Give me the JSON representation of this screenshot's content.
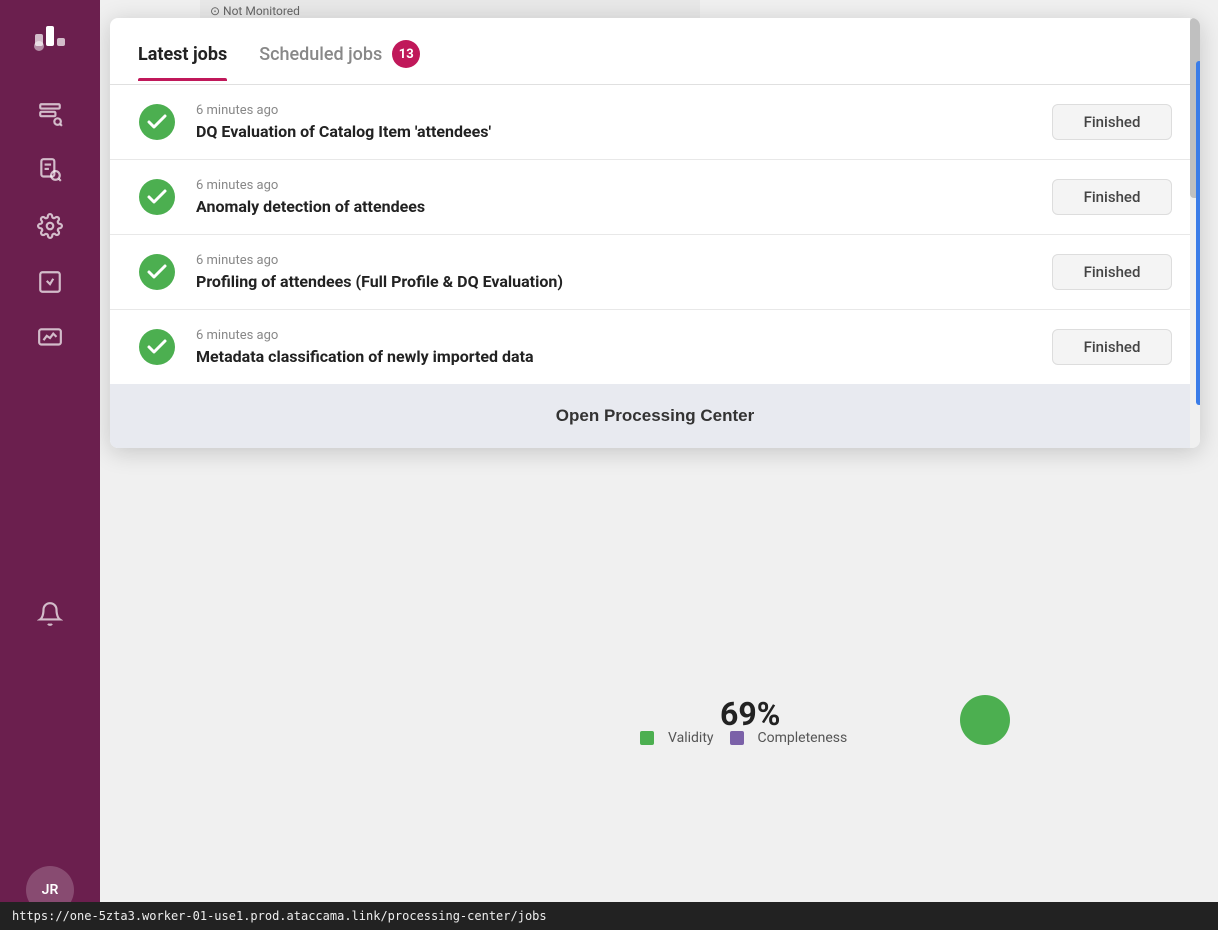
{
  "sidebar": {
    "logo_text": "bar-chart-icon",
    "items": [
      {
        "name": "sidebar-item-search",
        "icon": "search"
      },
      {
        "name": "sidebar-item-doc-search",
        "icon": "doc-search"
      },
      {
        "name": "sidebar-item-settings",
        "icon": "settings"
      },
      {
        "name": "sidebar-item-checklist",
        "icon": "checklist"
      },
      {
        "name": "sidebar-item-monitor",
        "icon": "monitor"
      },
      {
        "name": "sidebar-item-bell",
        "icon": "bell"
      }
    ],
    "avatar_label": "JR"
  },
  "tabs": {
    "latest_jobs_label": "Latest jobs",
    "scheduled_jobs_label": "Scheduled jobs",
    "scheduled_jobs_badge": "13"
  },
  "jobs": [
    {
      "time": "6 minutes ago",
      "name": "DQ Evaluation of Catalog Item 'attendees'",
      "status": "Finished"
    },
    {
      "time": "6 minutes ago",
      "name": "Anomaly detection of attendees",
      "status": "Finished"
    },
    {
      "time": "6 minutes ago",
      "name": "Profiling of attendees (Full Profile & DQ Evaluation)",
      "status": "Finished"
    },
    {
      "time": "6 minutes ago",
      "name": "Metadata classification of newly imported data",
      "status": "Finished"
    }
  ],
  "open_processing_center_label": "Open Processing Center",
  "bg": {
    "percent": "69%",
    "validity_label": "Validity",
    "completeness_label": "Completeness",
    "validity_color": "#4caf50",
    "completeness_color": "#7b61a8"
  },
  "url_bar_text": "https://one-5zta3.worker-01-use1.prod.ataccama.link/processing-center/jobs"
}
